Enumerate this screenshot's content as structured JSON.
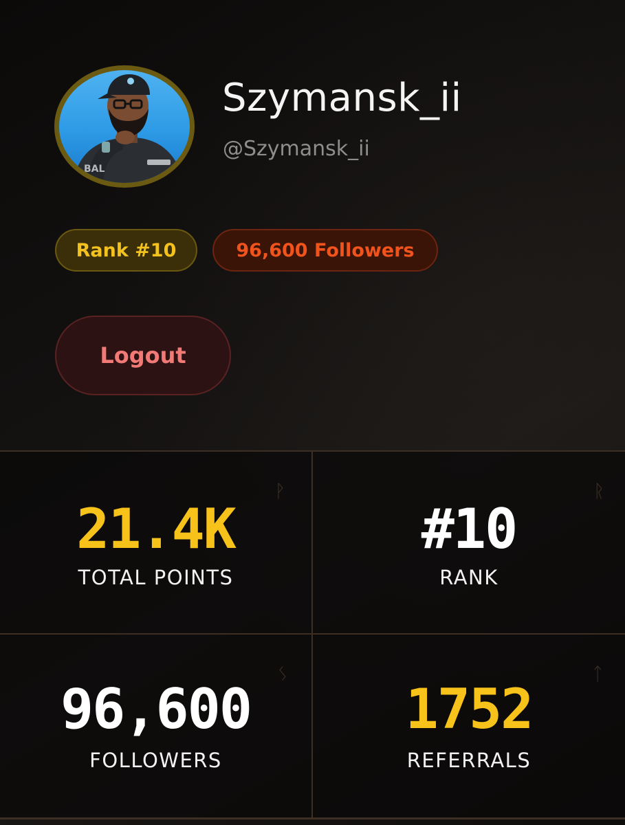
{
  "profile": {
    "display_name": "Szymansk_ii",
    "handle": "@Szymansk_ii",
    "avatar_icon": "user-avatar-photo"
  },
  "badges": {
    "rank": "Rank #10",
    "followers": "96,600 Followers"
  },
  "actions": {
    "logout_label": "Logout"
  },
  "stats": [
    {
      "value": "21.4K",
      "label": "TOTAL POINTS",
      "icon": "points-rune-icon",
      "glyph": "ᚹ",
      "accent": "#f7c21a"
    },
    {
      "value": "#10",
      "label": "RANK",
      "icon": "rank-rune-icon",
      "glyph": "ᚱ",
      "accent": "#ffffff"
    },
    {
      "value": "96,600",
      "label": "FOLLOWERS",
      "icon": "followers-rune-icon",
      "glyph": "ᛊ",
      "accent": "#ffffff"
    },
    {
      "value": "1752",
      "label": "REFERRALS",
      "icon": "referrals-rune-icon",
      "glyph": "ᛏ",
      "accent": "#f7c21a"
    }
  ],
  "colors": {
    "background": "#0e0c0b",
    "gold": "#f4c21f",
    "orange": "#f0531b",
    "logout_red": "#f27a76",
    "grid_line": "#3d2f24"
  }
}
